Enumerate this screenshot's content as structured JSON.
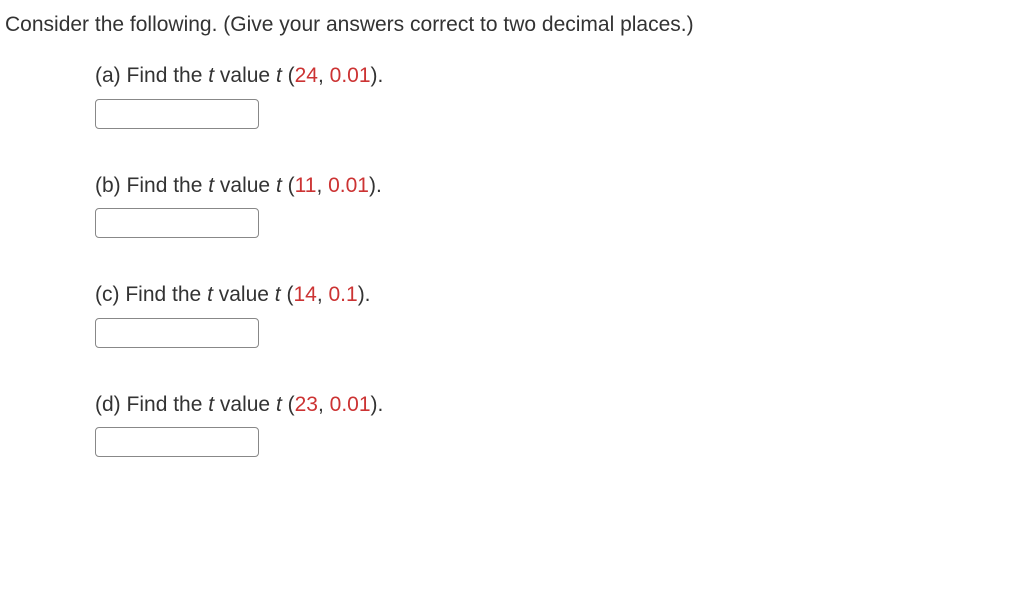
{
  "instruction": "Consider the following. (Give your answers correct to two decimal places.)",
  "questions": [
    {
      "label": "(a)",
      "prefix": "Find the ",
      "tvar1": "t",
      "middle": " value ",
      "tvar2": "t",
      "open": " (",
      "df": "24",
      "comma": ", ",
      "alpha": "0.01",
      "close": ")."
    },
    {
      "label": "(b)",
      "prefix": "Find the ",
      "tvar1": "t",
      "middle": " value ",
      "tvar2": "t",
      "open": " (",
      "df": "11",
      "comma": ", ",
      "alpha": "0.01",
      "close": ")."
    },
    {
      "label": "(c)",
      "prefix": "Find the ",
      "tvar1": "t",
      "middle": " value ",
      "tvar2": "t",
      "open": " (",
      "df": "14",
      "comma": ", ",
      "alpha": "0.1",
      "close": ")."
    },
    {
      "label": "(d)",
      "prefix": "Find the ",
      "tvar1": "t",
      "middle": " value ",
      "tvar2": "t",
      "open": " (",
      "df": "23",
      "comma": ", ",
      "alpha": "0.01",
      "close": ")."
    }
  ]
}
